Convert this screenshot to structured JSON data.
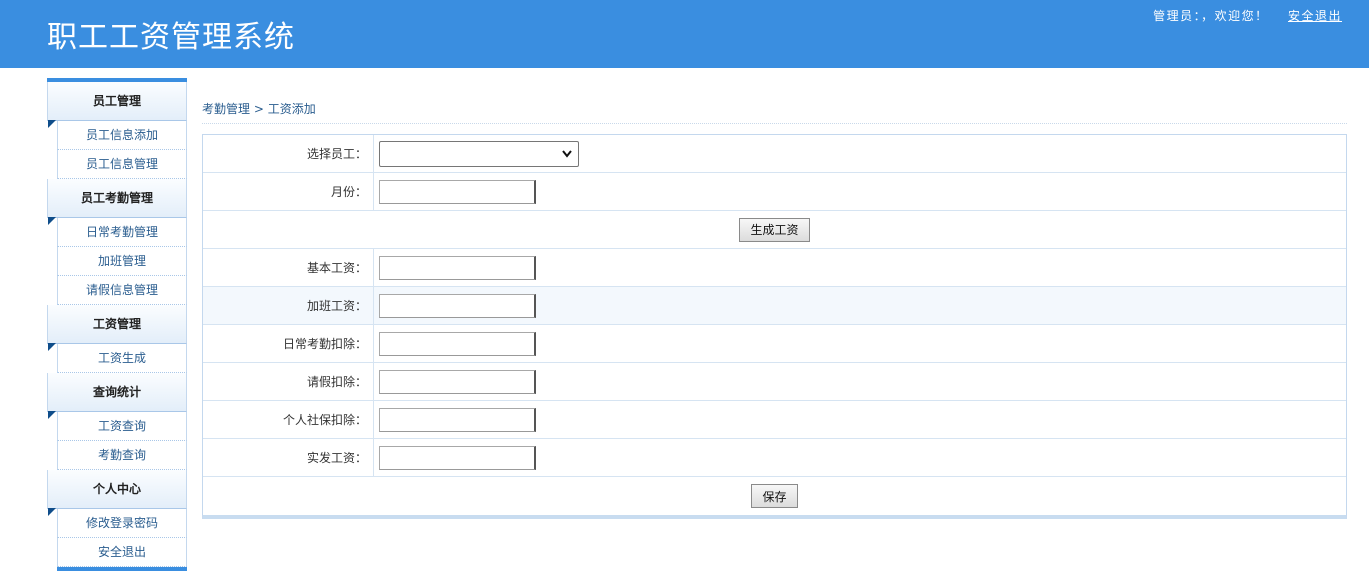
{
  "header": {
    "title": "职工工资管理系统",
    "welcome": "管理员：，欢迎您！",
    "logout": "安全退出"
  },
  "sidebar": {
    "groups": [
      {
        "title": "员工管理",
        "items": [
          "员工信息添加",
          "员工信息管理"
        ]
      },
      {
        "title": "员工考勤管理",
        "items": [
          "日常考勤管理",
          "加班管理",
          "请假信息管理"
        ]
      },
      {
        "title": "工资管理",
        "items": [
          "工资生成"
        ]
      },
      {
        "title": "查询统计",
        "items": [
          "工资查询",
          "考勤查询"
        ]
      },
      {
        "title": "个人中心",
        "items": [
          "修改登录密码",
          "安全退出"
        ]
      }
    ]
  },
  "breadcrumb": {
    "parent": "考勤管理",
    "separator": " > ",
    "current": "工资添加"
  },
  "form": {
    "select_employee_label": "选择员工：",
    "select_employee_value": "",
    "month_label": "月份：",
    "month_value": "",
    "generate_button": "生成工资",
    "base_salary_label": "基本工资：",
    "overtime_pay_label": "加班工资：",
    "attendance_deduction_label": "日常考勤扣除：",
    "leave_deduction_label": "请假扣除：",
    "social_insurance_label": "个人社保扣除：",
    "net_pay_label": "实发工资：",
    "save_button": "保存"
  },
  "colors": {
    "header_bg": "#3a8ee0",
    "link": "#2a5d8f",
    "accent_dark": "#0f4d8a"
  }
}
